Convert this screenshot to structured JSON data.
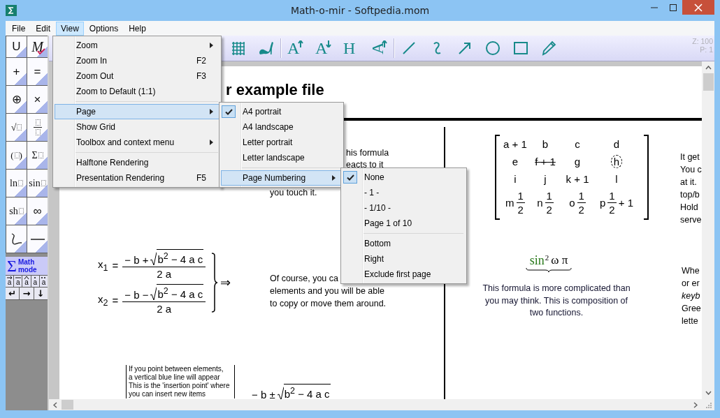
{
  "window": {
    "title": "Math-o-mir - Softpedia.mom"
  },
  "menu_bar": [
    {
      "label": "File",
      "selected": false
    },
    {
      "label": "Edit",
      "selected": false
    },
    {
      "label": "View",
      "selected": true
    },
    {
      "label": "Options",
      "selected": false
    },
    {
      "label": "Help",
      "selected": false
    }
  ],
  "toolbar": {
    "buttons": [
      {
        "kind": "grid"
      },
      {
        "kind": "shoe"
      },
      {
        "kind": "grow",
        "glyph": "A"
      },
      {
        "kind": "shrink",
        "glyph": "A"
      },
      {
        "kind": "letter",
        "glyph": "H"
      },
      {
        "kind": "rotate",
        "glyph": "A"
      },
      {
        "kind": "line"
      },
      {
        "kind": "curve"
      },
      {
        "kind": "arrow"
      },
      {
        "kind": "circle"
      },
      {
        "kind": "rectangle"
      },
      {
        "kind": "pen"
      }
    ],
    "zoom": "Z: 100",
    "page": "P: 1"
  },
  "toolbox": {
    "tools": [
      {
        "kind": "text",
        "label": "U"
      },
      {
        "kind": "marked",
        "label": "M"
      },
      {
        "kind": "text",
        "label": "+"
      },
      {
        "kind": "text",
        "label": "="
      },
      {
        "kind": "text",
        "label": "⊕"
      },
      {
        "kind": "text",
        "label": "×"
      },
      {
        "kind": "slot",
        "label": "√"
      },
      {
        "kind": "fraction"
      },
      {
        "kind": "wrap",
        "open": "(",
        "close": ")"
      },
      {
        "kind": "slot",
        "label": "Σ"
      },
      {
        "kind": "slot",
        "label": "ln"
      },
      {
        "kind": "slot",
        "label": "sin"
      },
      {
        "kind": "slot",
        "label": "sh"
      },
      {
        "kind": "text",
        "label": "∞"
      },
      {
        "kind": "curve"
      },
      {
        "kind": "line"
      }
    ],
    "math_mode": {
      "symbol": "Σ",
      "label": "Math mode"
    },
    "accents": [
      {
        "base": "a",
        "kind": "vector"
      },
      {
        "base": "a",
        "kind": "bar"
      },
      {
        "base": "a",
        "kind": "hat"
      },
      {
        "base": "a",
        "kind": "dot"
      },
      {
        "base": "a",
        "kind": "ddot"
      }
    ],
    "keys": [
      "↵",
      "→",
      "↓"
    ]
  },
  "document": {
    "heading": "r example file",
    "fragments": [
      "his formula",
      "eacts to it",
      "you touch it."
    ],
    "quadratic": {
      "rows": [
        {
          "var": "x$_{1}$",
          "eq": "=",
          "lead": "− b +",
          "radicand": "b$^{2}$ − 4 a c",
          "denominator": "2 a"
        },
        {
          "var": "x$_{2}$",
          "eq": "=",
          "lead": "− b −",
          "radicand": "b$^{2}$ − 4 a c",
          "denominator": "2 a"
        }
      ],
      "implies": "⇒"
    },
    "copy_note": [
      "Of course, you ca",
      "elements and you will be able",
      "to copy or move them around."
    ],
    "matrix": [
      [
        {
          "kind": "plain",
          "text": "a + 1"
        },
        {
          "kind": "plain",
          "text": "b"
        },
        {
          "kind": "plain",
          "text": "c"
        },
        {
          "kind": "plain",
          "text": "d"
        }
      ],
      [
        {
          "kind": "plain",
          "text": "e"
        },
        {
          "kind": "struck",
          "text": "f + 1"
        },
        {
          "kind": "plain",
          "text": "g"
        },
        {
          "kind": "circled",
          "text": "h"
        }
      ],
      [
        {
          "kind": "plain",
          "text": "i"
        },
        {
          "kind": "plain",
          "text": "j"
        },
        {
          "kind": "plain",
          "text": "k + 1"
        },
        {
          "kind": "plain",
          "text": "l"
        }
      ],
      [
        {
          "kind": "fraction",
          "text": "m",
          "num": "1",
          "den": "2"
        },
        {
          "kind": "fraction",
          "text": "n",
          "num": "1",
          "den": "2"
        },
        {
          "kind": "fraction",
          "text": "o",
          "num": "1",
          "den": "2"
        },
        {
          "kind": "fraction",
          "text": "p",
          "num": "1",
          "den": "2",
          "tail": "+ 1"
        }
      ]
    ],
    "composite": {
      "function": "sin",
      "power": "2",
      "argument": "ω π"
    },
    "caption": [
      "This formula is more complicated than",
      "you may think. This is composition of",
      "two functions."
    ],
    "right_column_top": [
      "It get",
      "You c",
      "at it.",
      "top/b",
      "Hold",
      "serve"
    ],
    "right_column_bottom": [
      {
        "text": "Whe",
        "italic": false
      },
      {
        "text": "or er",
        "italic": false
      },
      {
        "text": "keyb",
        "italic": true
      },
      {
        "text": "Gree",
        "italic": false
      },
      {
        "text": "lette",
        "italic": false
      }
    ],
    "insertion_note": [
      "If you point between elements,",
      "a vertical blue line will appear",
      "This is the 'insertion point' where",
      "you can insert new items"
    ],
    "bottom_formula": {
      "lead": "− b ±",
      "radicand": "b$^{2}$ − 4 a c"
    }
  },
  "view_menu": [
    {
      "kind": "item",
      "label": "Zoom",
      "submenu": true,
      "selected": false
    },
    {
      "kind": "item",
      "label": "Zoom In",
      "shortcut": "F2",
      "selected": false
    },
    {
      "kind": "item",
      "label": "Zoom Out",
      "shortcut": "F3",
      "selected": false
    },
    {
      "kind": "item",
      "label": "Zoom to Default (1:1)",
      "selected": false
    },
    {
      "kind": "separator"
    },
    {
      "kind": "item",
      "label": "Page",
      "submenu": true,
      "selected": true
    },
    {
      "kind": "item",
      "label": "Show Grid",
      "selected": false
    },
    {
      "kind": "item",
      "label": "Toolbox and context menu",
      "submenu": true,
      "selected": false
    },
    {
      "kind": "separator"
    },
    {
      "kind": "item",
      "label": "Halftone Rendering",
      "selected": false
    },
    {
      "kind": "item",
      "label": "Presentation Rendering",
      "shortcut": "F5",
      "selected": false
    }
  ],
  "page_menu": [
    {
      "kind": "item",
      "label": "A4 portrait",
      "checked": true,
      "selected": false
    },
    {
      "kind": "item",
      "label": "A4 landscape",
      "checked": false,
      "selected": false
    },
    {
      "kind": "item",
      "label": "Letter portrait",
      "checked": false,
      "selected": false
    },
    {
      "kind": "item",
      "label": "Letter landscape",
      "checked": false,
      "selected": false
    },
    {
      "kind": "separator"
    },
    {
      "kind": "item",
      "label": "Page Numbering",
      "submenu": true,
      "checked": false,
      "selected": true
    }
  ],
  "page_numbering_menu": [
    {
      "kind": "item",
      "label": "None",
      "checked": true,
      "selected": false
    },
    {
      "kind": "item",
      "label": "- 1 -",
      "checked": false,
      "selected": false
    },
    {
      "kind": "item",
      "label": "- 1/10 -",
      "checked": false,
      "selected": false
    },
    {
      "kind": "item",
      "label": "Page 1 of 10",
      "checked": false,
      "selected": false
    },
    {
      "kind": "separator"
    },
    {
      "kind": "item",
      "label": "Bottom",
      "checked": false,
      "selected": false
    },
    {
      "kind": "item",
      "label": "Right",
      "checked": false,
      "selected": false
    },
    {
      "kind": "item",
      "label": "Exclude first page",
      "checked": false,
      "selected": false
    }
  ]
}
